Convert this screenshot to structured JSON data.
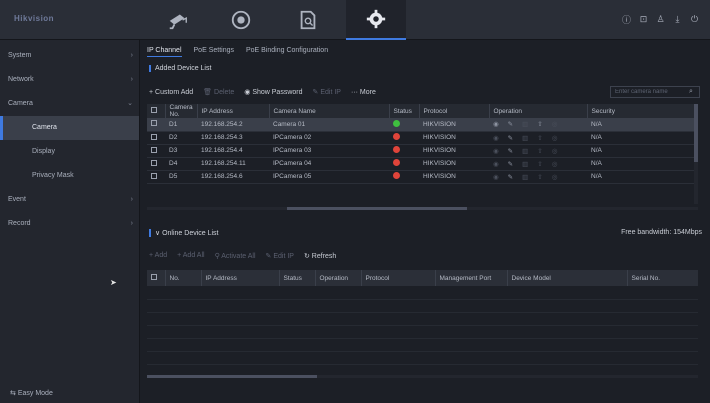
{
  "brand": {
    "logo_text": "Hikvision"
  },
  "top_tabs": [
    {
      "icon": "camera-icon",
      "active": false
    },
    {
      "icon": "playback-icon",
      "active": false
    },
    {
      "icon": "file-search-icon",
      "active": false
    },
    {
      "icon": "gear-icon",
      "active": true
    }
  ],
  "top_right_icons": [
    "info-icon",
    "lock-icon",
    "user-icon",
    "download-icon",
    "power-icon"
  ],
  "sidebar": {
    "items": [
      {
        "label": "System"
      },
      {
        "label": "Network"
      },
      {
        "label": "Camera"
      },
      {
        "label": "Camera"
      },
      {
        "label": "Display"
      },
      {
        "label": "Privacy Mask"
      },
      {
        "label": "Event"
      },
      {
        "label": "Record"
      }
    ],
    "easy_mode": "Easy Mode"
  },
  "subtabs": [
    {
      "label": "IP Channel"
    },
    {
      "label": "PoE Settings"
    },
    {
      "label": "PoE Binding Configuration"
    }
  ],
  "added_list": {
    "title": "Added Device List",
    "toolbar": {
      "custom_add": "+ Custom Add",
      "delete": "Delete",
      "show_password": "Show Password",
      "edit_ip": "Edit IP",
      "more": "More"
    },
    "search_placeholder": "Enter camera name",
    "columns": [
      "Camera No.",
      "IP Address",
      "Camera Name",
      "Status",
      "Protocol",
      "Operation",
      "Security"
    ],
    "rows": [
      {
        "no": "D1",
        "ip": "192.168.254.2",
        "name": "Camera 01",
        "status_color": "#3fbf3f",
        "protocol": "HIKVISION",
        "security": "N/A"
      },
      {
        "no": "D2",
        "ip": "192.168.254.3",
        "name": "IPCamera 02",
        "status_color": "#e0443a",
        "protocol": "HIKVISION",
        "security": "N/A"
      },
      {
        "no": "D3",
        "ip": "192.168.254.4",
        "name": "IPCamera 03",
        "status_color": "#e0443a",
        "protocol": "HIKVISION",
        "security": "N/A"
      },
      {
        "no": "D4",
        "ip": "192.168.254.11",
        "name": "IPCamera 04",
        "status_color": "#e0443a",
        "protocol": "HIKVISION",
        "security": "N/A"
      },
      {
        "no": "D5",
        "ip": "192.168.254.6",
        "name": "IPCamera 05",
        "status_color": "#e0443a",
        "protocol": "HIKVISION",
        "security": "N/A"
      }
    ]
  },
  "online_list": {
    "title": "Online Device List",
    "bandwidth": "Free bandwidth: 154Mbps",
    "toolbar": {
      "add": "+ Add",
      "add_all": "+ Add All",
      "activate_all": "Activate All",
      "edit_ip": "Edit IP",
      "refresh": "Refresh"
    },
    "columns": [
      "No.",
      "IP Address",
      "Status",
      "Operation",
      "Protocol",
      "Management Port",
      "Device Model",
      "Serial No."
    ]
  }
}
